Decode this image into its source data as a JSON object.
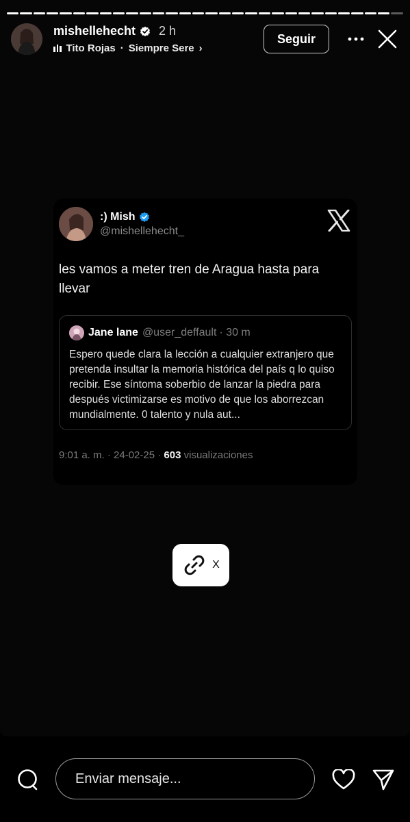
{
  "story": {
    "segments_total": 30,
    "segments_done": 29,
    "user": {
      "username": "mishellehecht",
      "verified": true,
      "time_ago": "2 h"
    },
    "music": {
      "artist": "Tito Rojas",
      "separator": "·",
      "song": "Siempre Sere",
      "chevron": "›"
    },
    "follow_label": "Seguir",
    "more_icon": "more-horizontal-icon",
    "close_icon": "close-icon"
  },
  "tweet": {
    "display_name": ":) Mish",
    "handle": "@mishellehecht_",
    "verified_color": "#1d9bf0",
    "logo": "x-logo-icon",
    "text": "les vamos a meter tren de Aragua hasta para llevar",
    "quote": {
      "name": "Jane lane",
      "handle": "@user_deffault",
      "time": "· 30 m",
      "text": "Espero quede clara la lección a cualquier extranjero que pretenda insultar la memoria histórica del país q lo quiso recibir. Ese síntoma soberbio de lanzar la piedra para después victimizarse es motivo de que los aborrezcan mundialmente. 0 talento y nula aut..."
    },
    "footer": {
      "time": "9:01 a. m. · 24-02-25 · ",
      "views_count": "603",
      "views_label": " visualizaciones"
    }
  },
  "link_sticker": {
    "label": "X",
    "icon": "link-icon"
  },
  "bottom_bar": {
    "message_placeholder": "Enviar mensaje...",
    "icons": [
      "search-icon",
      "heart-icon",
      "send-icon"
    ]
  }
}
